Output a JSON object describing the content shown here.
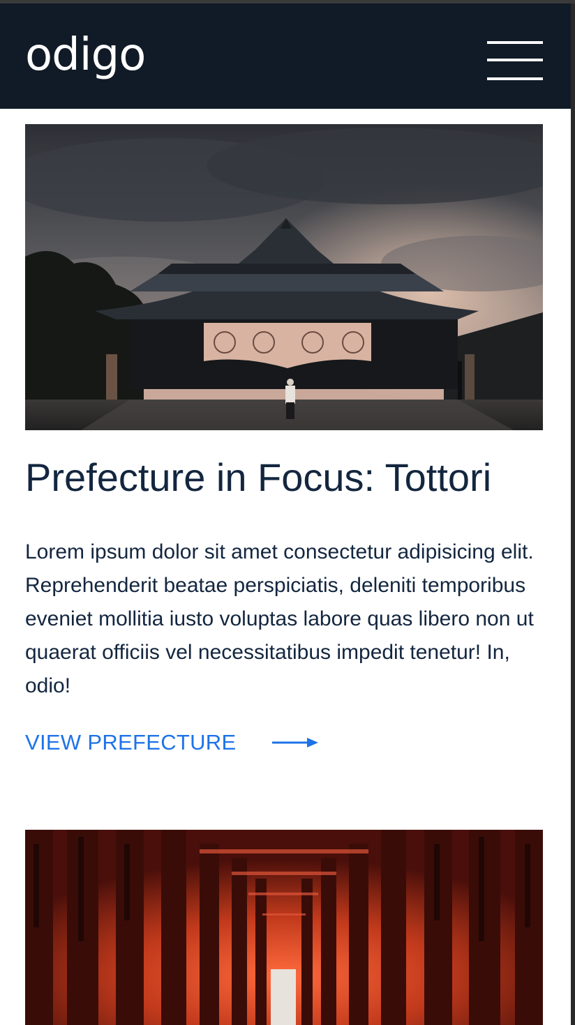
{
  "header": {
    "logo": "odigo",
    "menu_icon": "hamburger-menu-icon"
  },
  "card": {
    "image_alt": "Japanese shrine at dusk under cloudy sky",
    "title": "Prefecture in Focus: Tottori",
    "body": "Lorem ipsum dolor sit amet consectetur adipisicing elit. Reprehenderit beatae perspiciatis, deleniti temporibus eveniet mollitia iusto voluptas labore quas libero non ut quaerat officiis vel necessitatibus impedit tenetur! In, odio!",
    "cta_label": "VIEW PREFECTURE",
    "cta_icon": "arrow-right-icon"
  },
  "next_card": {
    "image_alt": "Red torii gate tunnel"
  },
  "colors": {
    "header_bg": "#111b27",
    "title": "#13263f",
    "accent": "#1e73e8"
  }
}
